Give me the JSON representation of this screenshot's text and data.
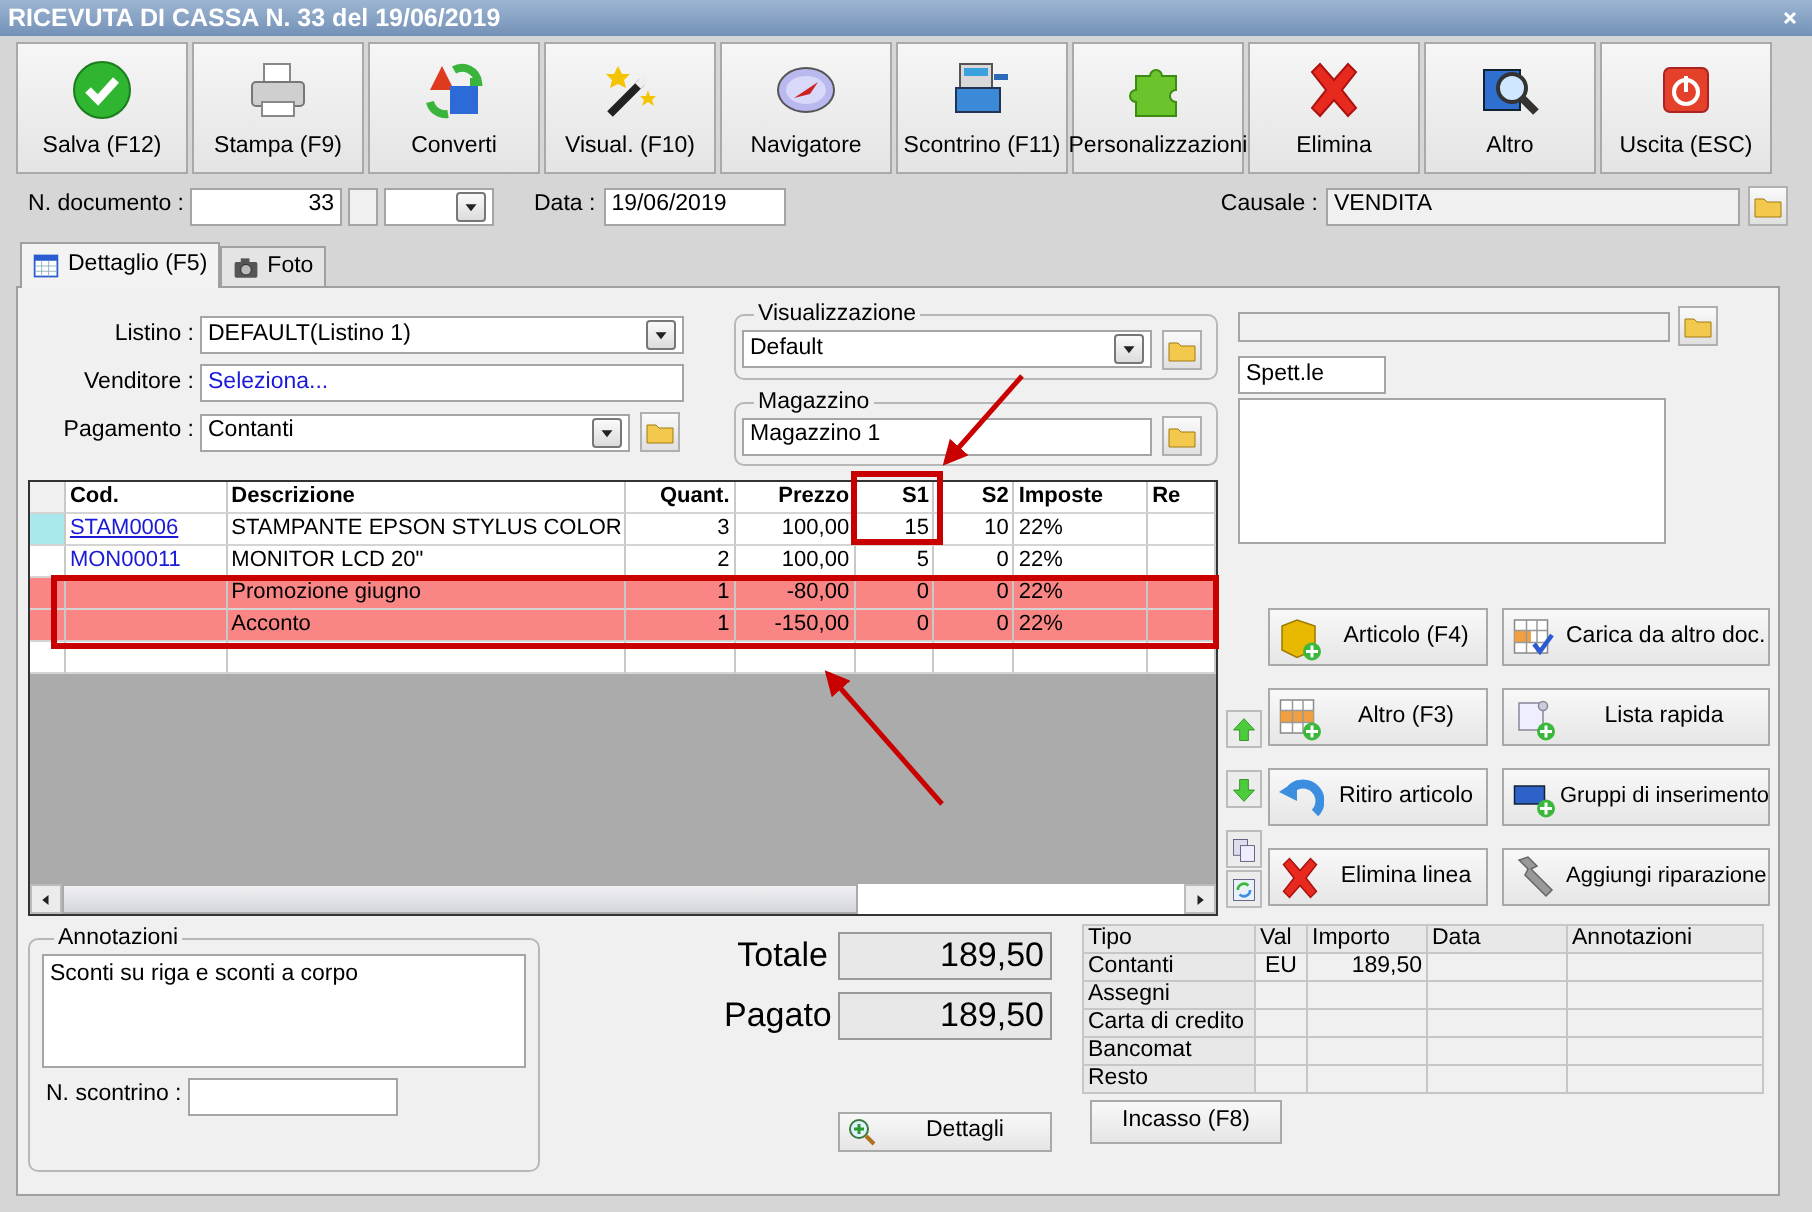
{
  "window": {
    "title": "RICEVUTA DI CASSA N. 33 del 19/06/2019"
  },
  "toolbar": [
    {
      "label": "Salva (F12)"
    },
    {
      "label": "Stampa (F9)"
    },
    {
      "label": "Converti"
    },
    {
      "label": "Visual. (F10)"
    },
    {
      "label": "Navigatore"
    },
    {
      "label": "Scontrino (F11)"
    },
    {
      "label": "Personalizzazioni"
    },
    {
      "label": "Elimina"
    },
    {
      "label": "Altro"
    },
    {
      "label": "Uscita (ESC)"
    }
  ],
  "header": {
    "number_label": "N. documento :",
    "number": "33",
    "date_label": "Data :",
    "date": "19/06/2019",
    "causale_label": "Causale :",
    "causale": "VENDITA"
  },
  "tabs": [
    {
      "label": "Dettaglio (F5)",
      "selected": true
    },
    {
      "label": "Foto",
      "selected": false
    }
  ],
  "form": {
    "listino_label": "Listino :",
    "listino": "DEFAULT(Listino 1)",
    "venditore_label": "Venditore :",
    "venditore": "Seleziona...",
    "pagamento_label": "Pagamento :",
    "pagamento": "Contanti"
  },
  "visualizzazione": {
    "title": "Visualizzazione",
    "value": "Default"
  },
  "magazzino": {
    "title": "Magazzino",
    "value": "Magazzino 1"
  },
  "table": {
    "columns": [
      "Cod.",
      "Descrizione",
      "Quant.",
      "Prezzo",
      "S1",
      "S2",
      "Imposte",
      "Re"
    ],
    "rows": [
      {
        "cod": "STAM0006",
        "descrizione": "STAMPANTE EPSON STYLUS COLOR",
        "quantita": "3",
        "prezzo": "100,00",
        "s1": "15",
        "s2": "10",
        "imposte": "22%",
        "current": true,
        "highlighted": false
      },
      {
        "cod": "MON00011",
        "descrizione": "MONITOR LCD 20\"",
        "quantita": "2",
        "prezzo": "100,00",
        "s1": "5",
        "s2": "0",
        "imposte": "22%",
        "current": false,
        "highlighted": false
      },
      {
        "descrizione": "Promozione giugno",
        "quantita": "1",
        "prezzo": "-80,00",
        "s1": "0",
        "s2": "0",
        "imposte": "22%",
        "current": false,
        "highlighted": true
      },
      {
        "descrizione": "Acconto",
        "quantita": "1",
        "prezzo": "-150,00",
        "s1": "0",
        "s2": "0",
        "imposte": "22%",
        "current": false,
        "highlighted": true
      }
    ]
  },
  "recipient": {
    "salutation": "Spett.le"
  },
  "actions": [
    {
      "label": "Articolo (F4)"
    },
    {
      "label": "Carica da altro doc."
    },
    {
      "label": "Altro (F3)"
    },
    {
      "label": "Lista rapida"
    },
    {
      "label": "Ritiro articolo"
    },
    {
      "label": "Gruppi di inserimento"
    },
    {
      "label": "Elimina linea"
    },
    {
      "label": "Aggiungi riparazione"
    }
  ],
  "notes": {
    "title": "Annotazioni",
    "text": "Sconti su riga e sconti a corpo",
    "receipt_label": "N. scontrino :"
  },
  "totals": [
    {
      "label": "Totale",
      "value": "189,50"
    },
    {
      "label": "Pagato",
      "value": "189,50"
    }
  ],
  "details_button": "Dettagli",
  "payments": {
    "columns": [
      "Tipo",
      "Val",
      "Importo",
      "Data",
      "Annotazioni"
    ],
    "rows": [
      {
        "tipo": "Contanti",
        "val": "EU",
        "importo": "189,50"
      },
      {
        "tipo": "Assegni"
      },
      {
        "tipo": "Carta di credito"
      },
      {
        "tipo": "Bancomat"
      },
      {
        "tipo": "Resto"
      }
    ]
  },
  "collect_button": "Incasso (F8)"
}
